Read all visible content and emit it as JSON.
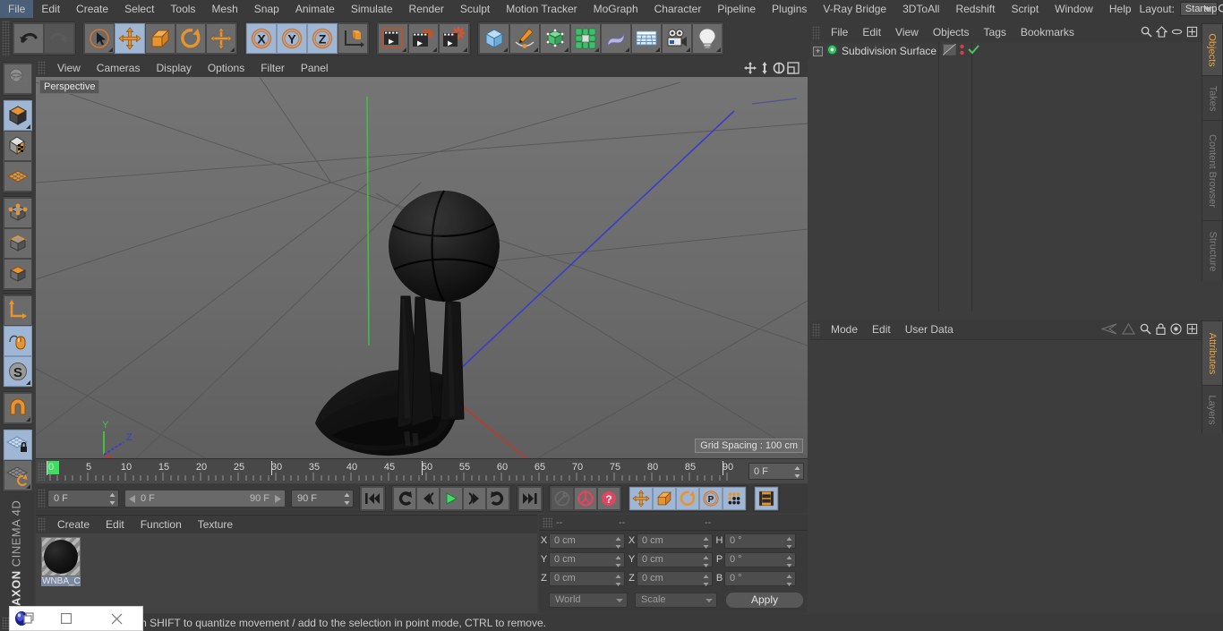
{
  "menubar": {
    "items": [
      "File",
      "Edit",
      "Create",
      "Select",
      "Tools",
      "Mesh",
      "Snap",
      "Animate",
      "Simulate",
      "Render",
      "Sculpt",
      "Motion Tracker",
      "MoGraph",
      "Character",
      "Pipeline",
      "Plugins",
      "V-Ray Bridge",
      "3DToAll",
      "Redshift",
      "Script",
      "Window",
      "Help"
    ],
    "layout_label": "Layout:",
    "layout_value": "Startup",
    "search_icon": "search-icon",
    "home_icon": "home-icon",
    "minimize_icon": "minimize-icon",
    "maximize_icon": "maximize-icon"
  },
  "toolbar": {
    "undo": "undo-icon",
    "redo": "redo-icon",
    "select": "live-selection-icon",
    "move": "move-icon",
    "scale": "scale-icon",
    "rotate": "rotate-icon",
    "move_alt": "move-alt-icon",
    "axis_x": "X",
    "axis_y": "Y",
    "axis_z": "Z",
    "world_coord": "world-coordinate-icon",
    "render_view": "render-view-icon",
    "render_region": "render-region-icon",
    "render_settings": "render-settings-icon",
    "cube": "add-cube-icon",
    "spline": "add-spline-icon",
    "generator": "add-generator-icon",
    "mograph": "add-mograph-icon",
    "deformer": "add-deformer-icon",
    "scene": "add-scene-icon",
    "camera": "add-camera-icon",
    "light": "add-light-icon"
  },
  "leftbar": {
    "items": [
      {
        "name": "make-editable-icon",
        "active": false
      },
      {
        "name": "model-mode-icon",
        "active": true
      },
      {
        "name": "texture-mode-icon",
        "active": false
      },
      {
        "name": "polygon-grid-icon",
        "active": false
      },
      {
        "name": "points-mode-icon",
        "active": false
      },
      {
        "name": "edges-mode-icon",
        "active": false
      },
      {
        "name": "polygons-mode-icon",
        "active": false
      },
      {
        "name": "axis-mode-icon",
        "active": false
      },
      {
        "name": "viewport-solo-icon",
        "active": true
      },
      {
        "name": "enable-snapping-icon",
        "active": true
      },
      {
        "name": "workplane-icon",
        "active": false
      },
      {
        "name": "workplane-lock-icon",
        "active": true
      },
      {
        "name": "workplane-align-icon",
        "active": false
      }
    ],
    "brand_bold": "MAXON",
    "brand_rest": "CINEMA 4D"
  },
  "viewport": {
    "menus": [
      "View",
      "Cameras",
      "Display",
      "Options",
      "Filter",
      "Panel"
    ],
    "label": "Perspective",
    "grid_spacing": "Grid Spacing : 100 cm",
    "axis_x": "X",
    "axis_y": "Y",
    "axis_z": "Z",
    "corner_icons": [
      "pan-view-icon",
      "dolly-view-icon",
      "rotate-view-icon",
      "maximize-view-icon"
    ],
    "colors": {
      "bg": "#6a6a6a",
      "x_axis": "#c8342b",
      "y_axis": "#3fc23f",
      "z_axis": "#3a3ad0",
      "model": "#141414"
    }
  },
  "timeline": {
    "ticks": [
      "0",
      "5",
      "10",
      "15",
      "20",
      "25",
      "30",
      "35",
      "40",
      "45",
      "50",
      "55",
      "60",
      "65",
      "70",
      "75",
      "80",
      "85",
      "90"
    ],
    "current_frame_right": "0 F",
    "current_frame": "0 F",
    "range_start": "0 F",
    "range_end": "90 F",
    "max_frame": "90 F",
    "playback": [
      {
        "name": "go-to-start-button",
        "icon": "skip-start-icon"
      },
      {
        "name": "play-backwards-button",
        "icon": "rewind-icon"
      },
      {
        "name": "step-back-button",
        "icon": "prev-frame-icon"
      },
      {
        "name": "play-forwards-button",
        "icon": "play-icon"
      },
      {
        "name": "step-forward-button",
        "icon": "next-frame-icon"
      },
      {
        "name": "play-loop-button",
        "icon": "loop-icon"
      },
      {
        "name": "go-to-end-button",
        "icon": "skip-end-icon"
      }
    ],
    "key_tools": [
      {
        "name": "record-active-objects-button",
        "icon": "key-icon"
      },
      {
        "name": "autokeying-button",
        "icon": "autokey-icon"
      },
      {
        "name": "keyframe-selection-button",
        "icon": "question-icon"
      }
    ],
    "pos_rot_scale": [
      {
        "name": "position-key-button",
        "icon": "move-icon",
        "active": true
      },
      {
        "name": "scale-key-button",
        "icon": "scale-icon",
        "active": true
      },
      {
        "name": "rotation-key-button",
        "icon": "rotate-icon",
        "active": true
      },
      {
        "name": "parameter-key-button",
        "icon": "param-icon",
        "active": true
      },
      {
        "name": "point-level-animation-button",
        "icon": "pla-icon",
        "active": true
      }
    ],
    "timeline_toggle": {
      "name": "timeline-toggle-button",
      "icon": "filmstrip-icon",
      "active": true
    }
  },
  "material_manager": {
    "menus": [
      "Create",
      "Edit",
      "Function",
      "Texture"
    ],
    "materials": [
      {
        "name": "WNBA_C",
        "swatch": "basketball-material"
      }
    ]
  },
  "coordinates": {
    "header_dashes": [
      "--",
      "--",
      "--"
    ],
    "position": {
      "label_x": "X",
      "label_y": "Y",
      "label_z": "Z",
      "x": "0 cm",
      "y": "0 cm",
      "z": "0 cm"
    },
    "size": {
      "label_x": "X",
      "label_y": "Y",
      "label_z": "Z",
      "x": "0 cm",
      "y": "0 cm",
      "z": "0 cm"
    },
    "rotation": {
      "label_h": "H",
      "label_p": "P",
      "label_b": "B",
      "h": "0 °",
      "p": "0 °",
      "b": "0 °"
    },
    "coord_system": "World",
    "transform_mode": "Scale",
    "apply_label": "Apply"
  },
  "object_manager": {
    "menus": [
      "File",
      "Edit",
      "View",
      "Objects",
      "Tags",
      "Bookmarks"
    ],
    "icons": [
      "search-icon",
      "home-icon",
      "ellipse-icon",
      "new-panel-icon"
    ],
    "objects": [
      {
        "name": "Subdivision Surface",
        "icon": "subdivision-surface-icon",
        "expandable": true,
        "tags": [
          "display-tag",
          "dots-tag",
          "check-tag"
        ]
      }
    ]
  },
  "attribute_manager": {
    "menus": [
      "Mode",
      "Edit",
      "User Data"
    ],
    "icons": [
      "history-back-icon",
      "history-forward-icon",
      "search-icon",
      "lock-icon",
      "target-icon",
      "new-panel-icon"
    ]
  },
  "vtabs_top": [
    {
      "label": "Objects",
      "active": true
    },
    {
      "label": "Takes",
      "active": false
    },
    {
      "label": "Content Browser",
      "active": false
    },
    {
      "label": "Structure",
      "active": false
    }
  ],
  "vtabs_bottom": [
    {
      "label": "Attributes",
      "active": true
    },
    {
      "label": "Layers",
      "active": false
    }
  ],
  "statusbar": {
    "text": "move elements. Hold down SHIFT to quantize movement / add to the selection in point mode, CTRL to remove."
  },
  "floating_window": {
    "app_icon": "app-icon",
    "restore_icon": "restore-icon",
    "maximize_icon": "maximize-square-icon",
    "close_icon": "close-icon"
  }
}
